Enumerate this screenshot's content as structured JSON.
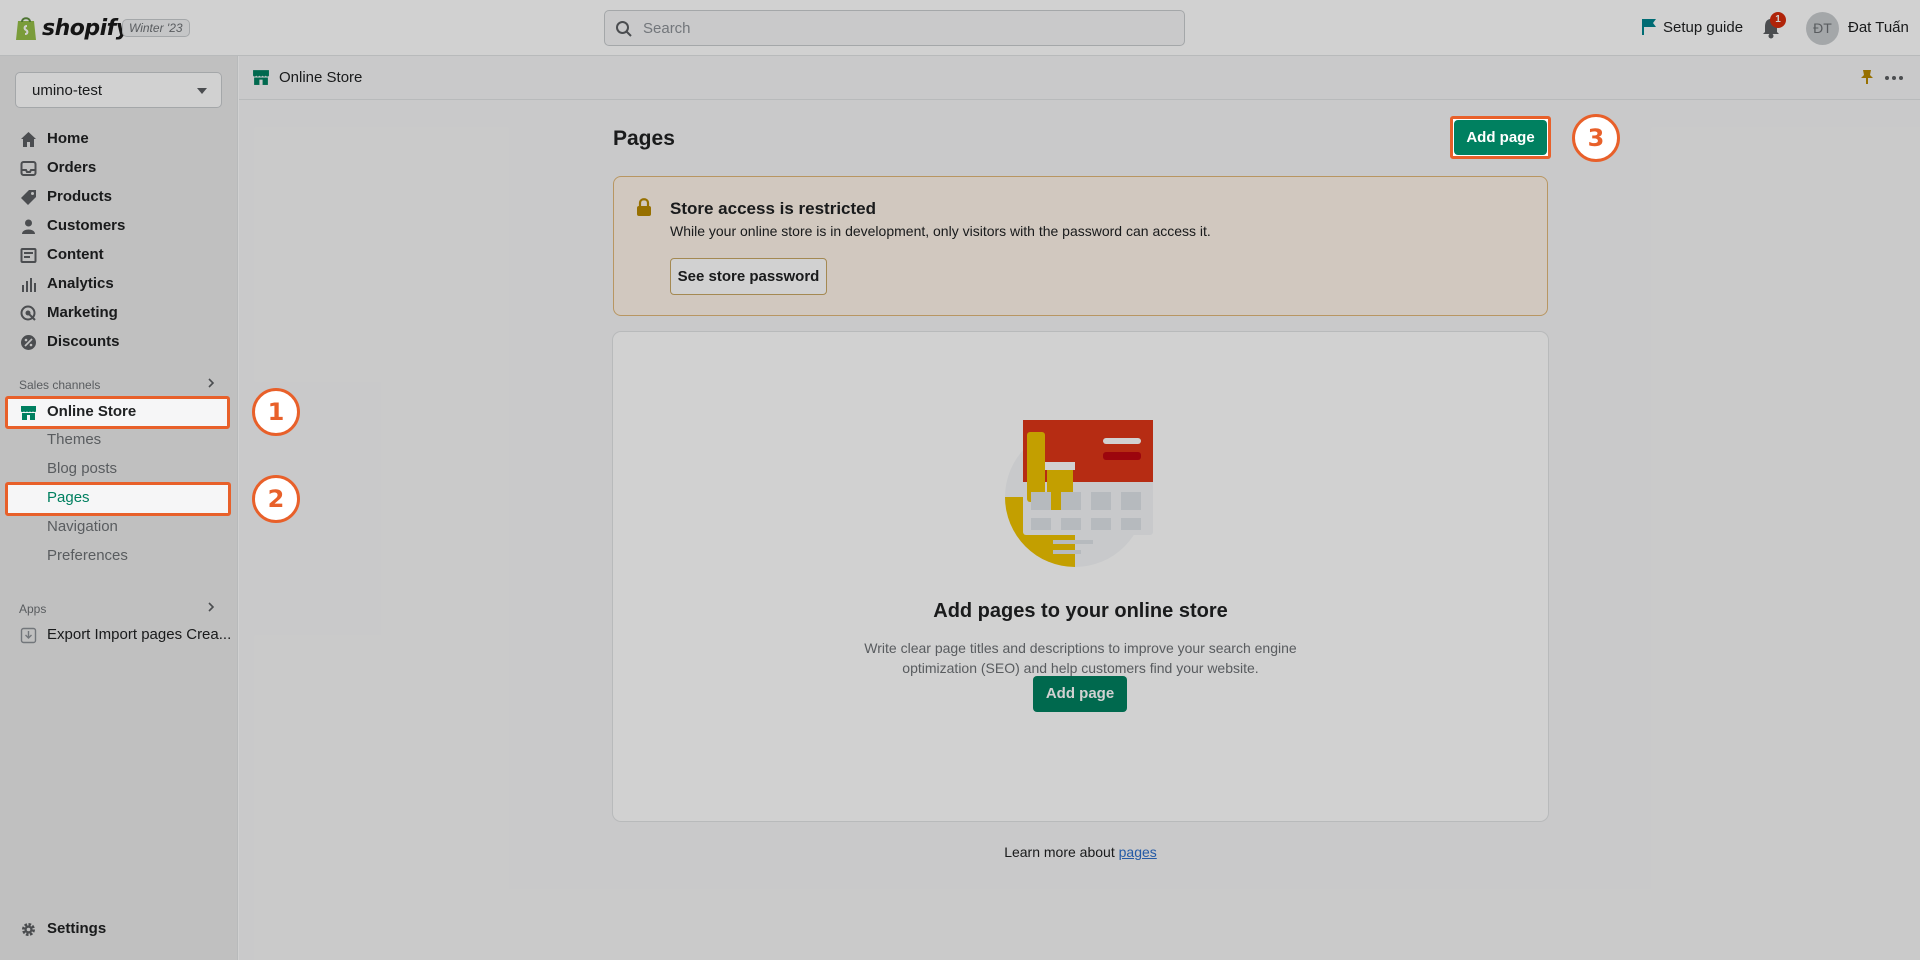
{
  "topbar": {
    "logo_text": "shopify",
    "edition": "Winter '23",
    "search_placeholder": "Search",
    "setup_guide": "Setup guide",
    "notification_count": "1",
    "avatar_initials": "ĐT",
    "user_name": "Đat Tuấn"
  },
  "sidebar": {
    "store_name": "umino-test",
    "main_items": [
      {
        "label": "Home",
        "icon": "home-icon"
      },
      {
        "label": "Orders",
        "icon": "inbox-icon"
      },
      {
        "label": "Products",
        "icon": "tag-icon"
      },
      {
        "label": "Customers",
        "icon": "person-icon"
      },
      {
        "label": "Content",
        "icon": "image-icon"
      },
      {
        "label": "Analytics",
        "icon": "bar-chart-icon"
      },
      {
        "label": "Marketing",
        "icon": "target-icon"
      },
      {
        "label": "Discounts",
        "icon": "discount-icon"
      }
    ],
    "sales_channels_title": "Sales channels",
    "online_store": "Online Store",
    "online_store_subitems": [
      "Themes",
      "Blog posts",
      "Pages",
      "Navigation",
      "Preferences"
    ],
    "apps_title": "Apps",
    "app_item": "Export Import pages Crea...",
    "settings": "Settings"
  },
  "main": {
    "breadcrumb": "Online Store",
    "page_title": "Pages",
    "add_page_button": "Add page",
    "banner": {
      "title": "Store access is restricted",
      "text": "While your online store is in development, only visitors with the password can access it.",
      "button": "See store password"
    },
    "empty_state": {
      "title": "Add pages to your online store",
      "text": "Write clear page titles and descriptions to improve your search engine optimization (SEO) and help customers find your website.",
      "button": "Add page"
    },
    "learn_more_prefix": "Learn more about",
    "learn_more_link": "pages"
  },
  "annotations": {
    "step1": "1",
    "step2": "2",
    "step3": "3",
    "highlight_color": "#e8602a"
  },
  "colors": {
    "primary": "#008060",
    "warning_bg": "#fff5ea",
    "link": "#2c6ecb"
  }
}
